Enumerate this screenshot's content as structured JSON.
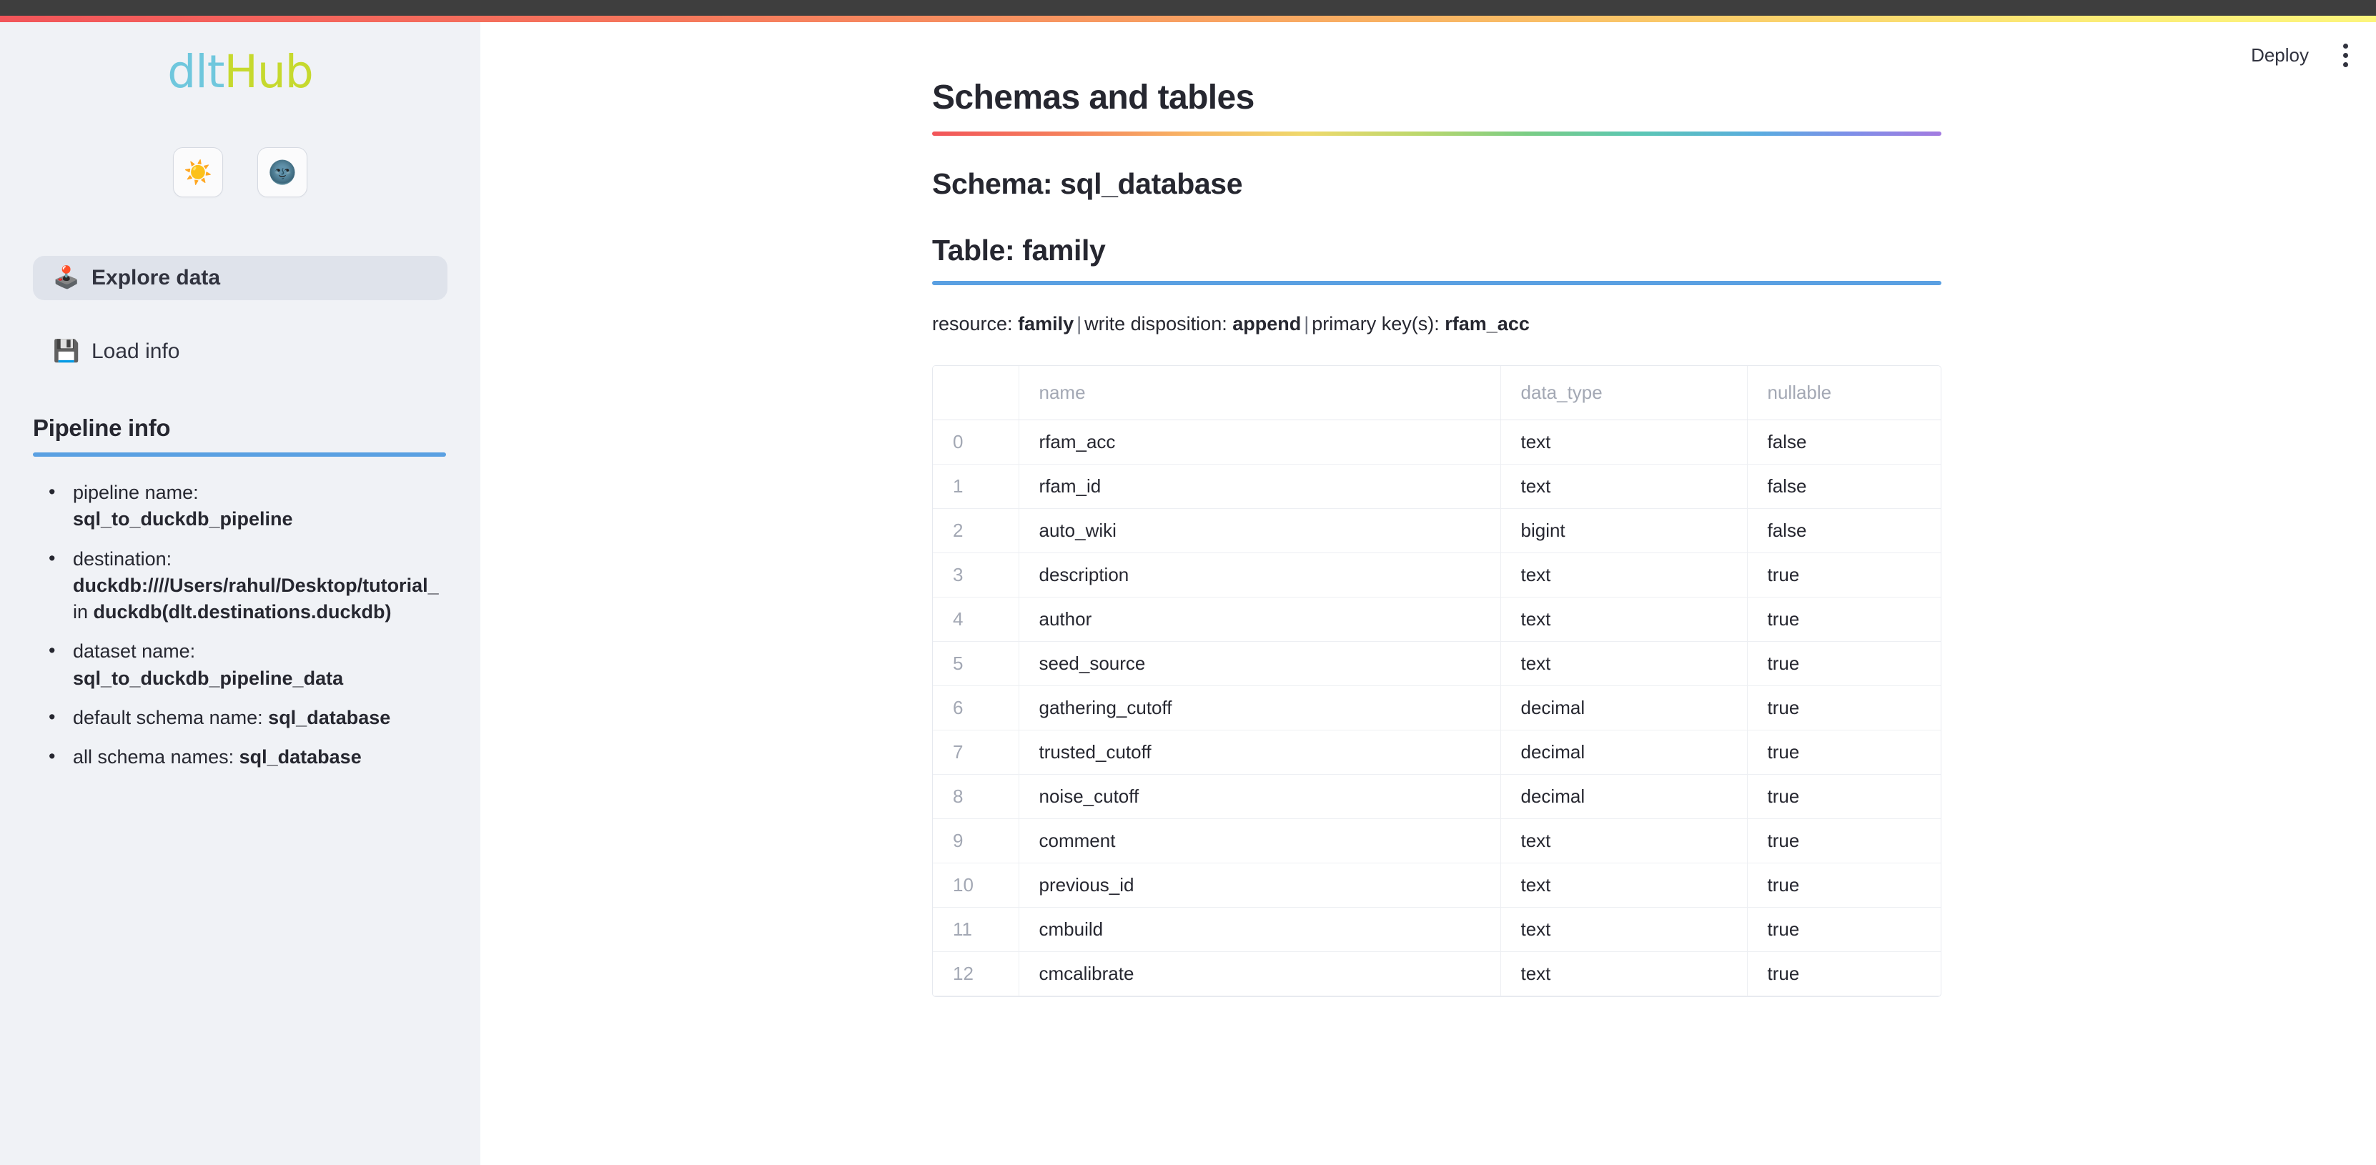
{
  "topbar": {
    "deploy_label": "Deploy",
    "menu_icon": "kebab-menu-icon",
    "dark_bar_color": "#3E3E3E",
    "gradient_from": "#F2555A",
    "gradient_to": "#FCF57C"
  },
  "sidebar": {
    "logo": {
      "part1": "dlt",
      "part2": "Hub",
      "color1": "#6FC7DD",
      "color2": "#C6D92E"
    },
    "theme_buttons": [
      {
        "name": "light-theme-button",
        "glyph": "☀️"
      },
      {
        "name": "dark-theme-button",
        "glyph": "🌚"
      }
    ],
    "nav": [
      {
        "name": "sidebar-item-explore-data",
        "icon": "🕹️",
        "label": "Explore data",
        "selected": true
      },
      {
        "name": "sidebar-item-load-info",
        "icon": "💾",
        "label": "Load info",
        "selected": false
      }
    ],
    "pipeline_info": {
      "heading": "Pipeline info",
      "rule_color": "#5AA0E2",
      "items": [
        {
          "label": "pipeline name:",
          "value": "sql_to_duckdb_pipeline",
          "wrap": true
        },
        {
          "label": "destination:",
          "value": "duckdb:////Users/rahul/Desktop/tutorial_",
          "value2_prefix": "in ",
          "value2": "duckdb(dlt.destinations.duckdb)",
          "wrap": true
        },
        {
          "label": "dataset name:",
          "value": "sql_to_duckdb_pipeline_data",
          "wrap": true
        },
        {
          "label": "default schema name:",
          "value": "sql_database",
          "wrap": false
        },
        {
          "label": "all schema names:",
          "value": "sql_database",
          "wrap": false
        }
      ]
    }
  },
  "main": {
    "page_title": "Schemas and tables",
    "schema_title": "Schema: sql_database",
    "table_title": "Table: family",
    "resource": {
      "label1": "resource: ",
      "value1": "family",
      "label2": "write disposition: ",
      "value2": "append",
      "label3": "primary key(s): ",
      "value3": "rfam_acc",
      "separator": "|"
    },
    "table": {
      "columns": [
        "",
        "name",
        "data_type",
        "nullable"
      ],
      "rows": [
        {
          "index": "0",
          "name": "rfam_acc",
          "data_type": "text",
          "nullable": "false"
        },
        {
          "index": "1",
          "name": "rfam_id",
          "data_type": "text",
          "nullable": "false"
        },
        {
          "index": "2",
          "name": "auto_wiki",
          "data_type": "bigint",
          "nullable": "false"
        },
        {
          "index": "3",
          "name": "description",
          "data_type": "text",
          "nullable": "true"
        },
        {
          "index": "4",
          "name": "author",
          "data_type": "text",
          "nullable": "true"
        },
        {
          "index": "5",
          "name": "seed_source",
          "data_type": "text",
          "nullable": "true"
        },
        {
          "index": "6",
          "name": "gathering_cutoff",
          "data_type": "decimal",
          "nullable": "true"
        },
        {
          "index": "7",
          "name": "trusted_cutoff",
          "data_type": "decimal",
          "nullable": "true"
        },
        {
          "index": "8",
          "name": "noise_cutoff",
          "data_type": "decimal",
          "nullable": "true"
        },
        {
          "index": "9",
          "name": "comment",
          "data_type": "text",
          "nullable": "true"
        },
        {
          "index": "10",
          "name": "previous_id",
          "data_type": "text",
          "nullable": "true"
        },
        {
          "index": "11",
          "name": "cmbuild",
          "data_type": "text",
          "nullable": "true"
        },
        {
          "index": "12",
          "name": "cmcalibrate",
          "data_type": "text",
          "nullable": "true"
        }
      ]
    }
  }
}
